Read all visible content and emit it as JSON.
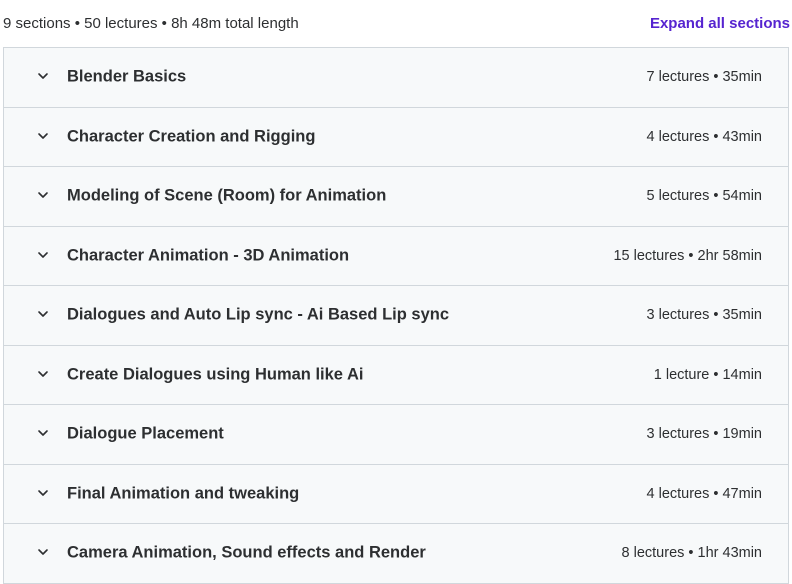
{
  "summary": "9 sections • 50 lectures • 8h 48m total length",
  "expand_label": "Expand all sections",
  "colors": {
    "accent": "#5624d0",
    "text": "#2d2f31",
    "row_bg": "#f7f9fa",
    "border": "#d1d7dc"
  },
  "sections": [
    {
      "title": "Blender Basics",
      "meta": "7 lectures • 35min",
      "icon": "chevron-down-icon"
    },
    {
      "title": "Character Creation and Rigging",
      "meta": "4 lectures • 43min",
      "icon": "chevron-down-icon"
    },
    {
      "title": "Modeling of Scene (Room) for Animation",
      "meta": "5 lectures • 54min",
      "icon": "chevron-down-icon"
    },
    {
      "title": "Character Animation - 3D Animation",
      "meta": "15 lectures • 2hr 58min",
      "icon": "chevron-down-icon"
    },
    {
      "title": "Dialogues and Auto Lip sync - Ai Based Lip sync",
      "meta": "3 lectures • 35min",
      "icon": "chevron-down-icon"
    },
    {
      "title": "Create Dialogues using Human like Ai",
      "meta": "1 lecture • 14min",
      "icon": "chevron-down-icon"
    },
    {
      "title": "Dialogue Placement",
      "meta": "3 lectures • 19min",
      "icon": "chevron-down-icon"
    },
    {
      "title": "Final Animation and tweaking",
      "meta": "4 lectures • 47min",
      "icon": "chevron-down-icon"
    },
    {
      "title": "Camera Animation, Sound effects and Render",
      "meta": "8 lectures • 1hr 43min",
      "icon": "chevron-down-icon"
    }
  ]
}
